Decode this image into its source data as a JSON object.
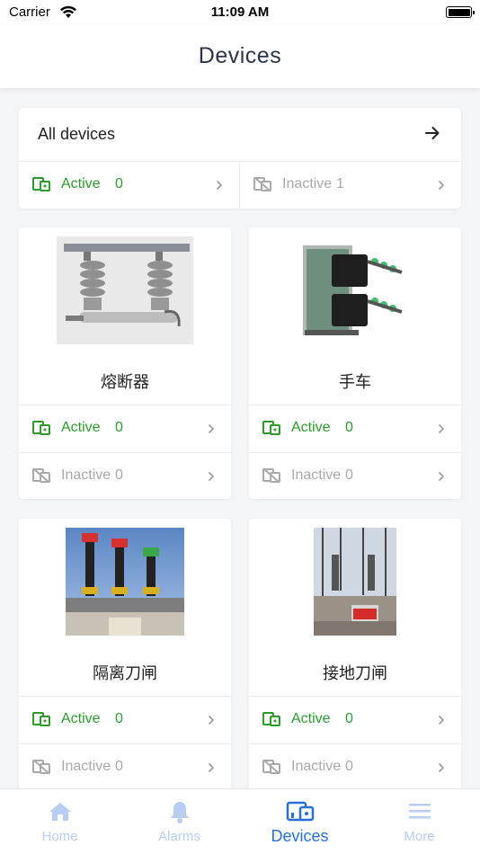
{
  "status_bar": {
    "carrier": "Carrier",
    "time": "11:09 AM"
  },
  "header": {
    "title": "Devices"
  },
  "all_devices": {
    "title": "All devices",
    "active_label": "Active",
    "active_count": "0",
    "inactive_label": "Inactive",
    "inactive_count": "1"
  },
  "devices": [
    {
      "name": "熔断器",
      "active_label": "Active",
      "active_count": "0",
      "inactive_label": "Inactive",
      "inactive_count": "0"
    },
    {
      "name": "手车",
      "active_label": "Active",
      "active_count": "0",
      "inactive_label": "Inactive",
      "inactive_count": "0"
    },
    {
      "name": "隔离刀闸",
      "active_label": "Active",
      "active_count": "0",
      "inactive_label": "Inactive",
      "inactive_count": "0"
    },
    {
      "name": "接地刀闸",
      "active_label": "Active",
      "active_count": "0",
      "inactive_label": "Inactive",
      "inactive_count": "0"
    }
  ],
  "tabbar": {
    "home": "Home",
    "alarms": "Alarms",
    "devices": "Devices",
    "more": "More"
  },
  "colors": {
    "active": "#2e9a2e",
    "inactive": "#a9a9a9",
    "tab_selected": "#2a6fd8",
    "tab_unselected": "#b9ccf2"
  },
  "icons": {
    "wifi": "wifi-icon",
    "battery": "battery-icon",
    "arrow": "arrow-right-icon",
    "active": "device-active-icon",
    "inactive": "device-inactive-icon",
    "chevron": "chevron-right-icon",
    "home": "home-icon",
    "alarms": "bell-icon",
    "devices": "devices-icon",
    "more": "menu-icon"
  }
}
